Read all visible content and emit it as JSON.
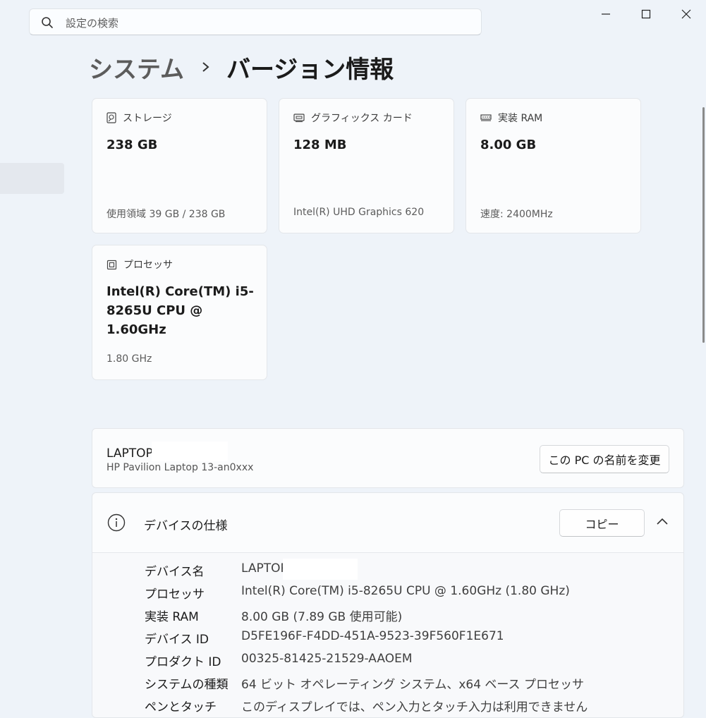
{
  "search": {
    "placeholder": "設定の検索"
  },
  "breadcrumb": {
    "parent": "システム",
    "current": "バージョン情報"
  },
  "cards": [
    {
      "title": "ストレージ",
      "icon": "storage-icon",
      "value": "238 GB",
      "sub": "使用領域 39 GB / 238 GB"
    },
    {
      "title": "グラフィックス カード",
      "icon": "graphics-card-icon",
      "value": "128 MB",
      "sub": "Intel(R) UHD Graphics 620"
    },
    {
      "title": "実装 RAM",
      "icon": "ram-icon",
      "value": "8.00 GB",
      "sub": "速度: 2400MHz"
    },
    {
      "title": "プロセッサ",
      "icon": "processor-icon",
      "value": "Intel(R) Core(TM) i5-8265U CPU @ 1.60GHz",
      "sub": "1.80 GHz"
    }
  ],
  "pc": {
    "name": "LAPTOP",
    "model": "HP Pavilion Laptop 13-an0xxx",
    "rename_label": "この PC の名前を変更"
  },
  "specs": {
    "title": "デバイスの仕様",
    "copy_label": "コピー",
    "rows": [
      {
        "key": "デバイス名",
        "value": "LAPTOP"
      },
      {
        "key": "プロセッサ",
        "value": "Intel(R) Core(TM) i5-8265U CPU @ 1.60GHz (1.80 GHz)"
      },
      {
        "key": "実装 RAM",
        "value": "8.00 GB (7.89 GB 使用可能)"
      },
      {
        "key": "デバイス ID",
        "value": "D5FE196F-F4DD-451A-9523-39F560F1E671"
      },
      {
        "key": "プロダクト ID",
        "value": "00325-81425-21529-AAOEM"
      },
      {
        "key": "システムの種類",
        "value": "64 ビット オペレーティング システム、x64 ベース プロセッサ"
      },
      {
        "key": "ペンとタッチ",
        "value": "このディスプレイでは、ペン入力とタッチ入力は利用できません"
      }
    ]
  }
}
